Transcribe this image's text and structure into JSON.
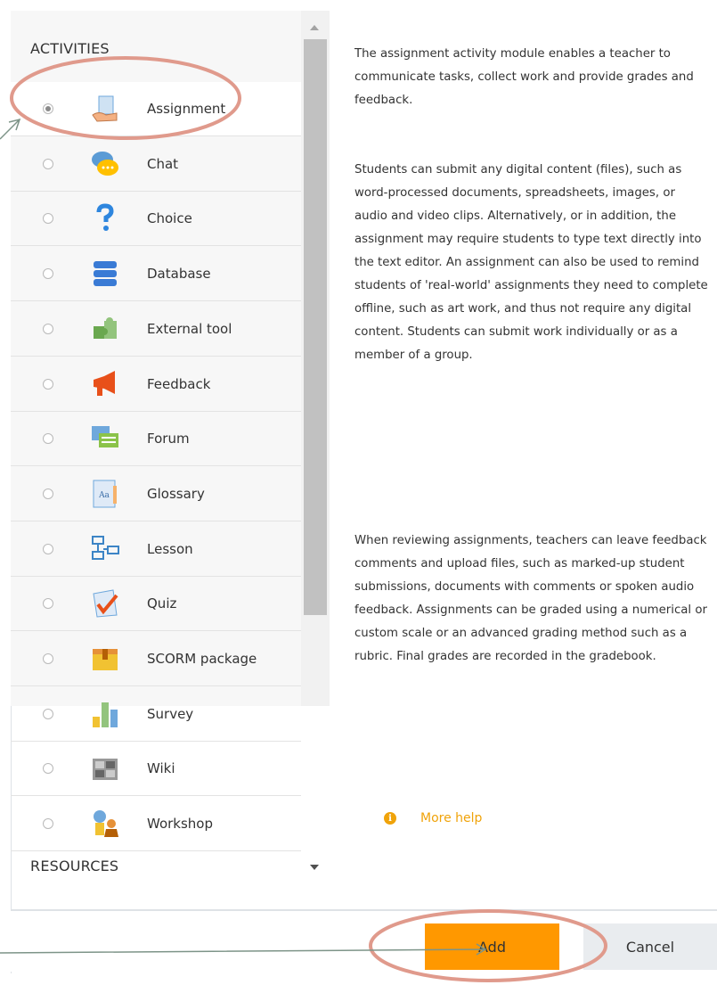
{
  "activities": {
    "heading": "ACTIVITIES",
    "items": [
      {
        "label": "Assignment",
        "icon": "assignment-icon",
        "selected": true
      },
      {
        "label": "Chat",
        "icon": "chat-icon",
        "selected": false
      },
      {
        "label": "Choice",
        "icon": "choice-icon",
        "selected": false
      },
      {
        "label": "Database",
        "icon": "database-icon",
        "selected": false
      },
      {
        "label": "External tool",
        "icon": "external-tool-icon",
        "selected": false
      },
      {
        "label": "Feedback",
        "icon": "feedback-icon",
        "selected": false
      },
      {
        "label": "Forum",
        "icon": "forum-icon",
        "selected": false
      },
      {
        "label": "Glossary",
        "icon": "glossary-icon",
        "selected": false
      },
      {
        "label": "Lesson",
        "icon": "lesson-icon",
        "selected": false
      },
      {
        "label": "Quiz",
        "icon": "quiz-icon",
        "selected": false
      },
      {
        "label": "SCORM package",
        "icon": "scorm-package-icon",
        "selected": false
      },
      {
        "label": "Survey",
        "icon": "survey-icon",
        "selected": false
      },
      {
        "label": "Wiki",
        "icon": "wiki-icon",
        "selected": false
      },
      {
        "label": "Workshop",
        "icon": "workshop-icon",
        "selected": false
      }
    ]
  },
  "resources": {
    "heading": "RESOURCES"
  },
  "description": {
    "p1": "The assignment activity module enables a teacher to communicate tasks, collect work and provide grades and feedback.",
    "p2": "Students can submit any digital content (files), such as word-processed documents, spreadsheets, images, or audio and video clips. Alternatively, or in addition, the assignment may require students to type text directly into the text editor. An assignment can also be used to remind students of 'real-world' assignments they need to complete offline, such as art work, and thus not require any digital content. Students can submit work individually or as a member of a group.",
    "p3": "When reviewing assignments, teachers can leave feedback comments and upload files, such as marked-up student submissions, documents with comments or spoken audio feedback. Assignments can be graded using a numerical or custom scale or an advanced grading method such as a rubric. Final grades are recorded in the gradebook.",
    "more_help": "More help",
    "info_glyph": "i"
  },
  "footer": {
    "add_label": "Add",
    "cancel_label": "Cancel"
  },
  "colors": {
    "accent": "#ff9800",
    "help": "#f0a30a",
    "annotation_circle": "#e09a8c",
    "annotation_arrow": "#7d9488"
  }
}
